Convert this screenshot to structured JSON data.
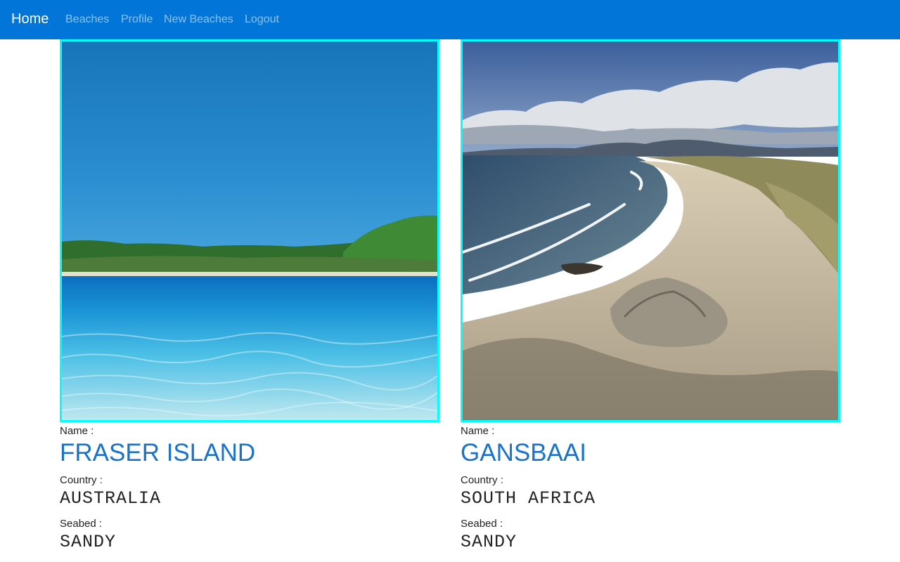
{
  "nav": {
    "brand": "Home",
    "links": [
      "Beaches",
      "Profile",
      "New Beaches",
      "Logout"
    ],
    "background_color": "#0275d8"
  },
  "labels": {
    "name": "Name :",
    "country": "Country :",
    "seabed": "Seabed :"
  },
  "beaches": [
    {
      "name": "FRASER ISLAND",
      "country": "AUSTRALIA",
      "seabed": "SANDY",
      "photo": "fraser-island-beach-photo"
    },
    {
      "name": "GANSBAAI",
      "country": "SOUTH AFRICA",
      "seabed": "SANDY",
      "photo": "gansbaai-beach-photo"
    }
  ],
  "colors": {
    "photo_border": "#00ffff",
    "name_text": "#1a73c8"
  }
}
